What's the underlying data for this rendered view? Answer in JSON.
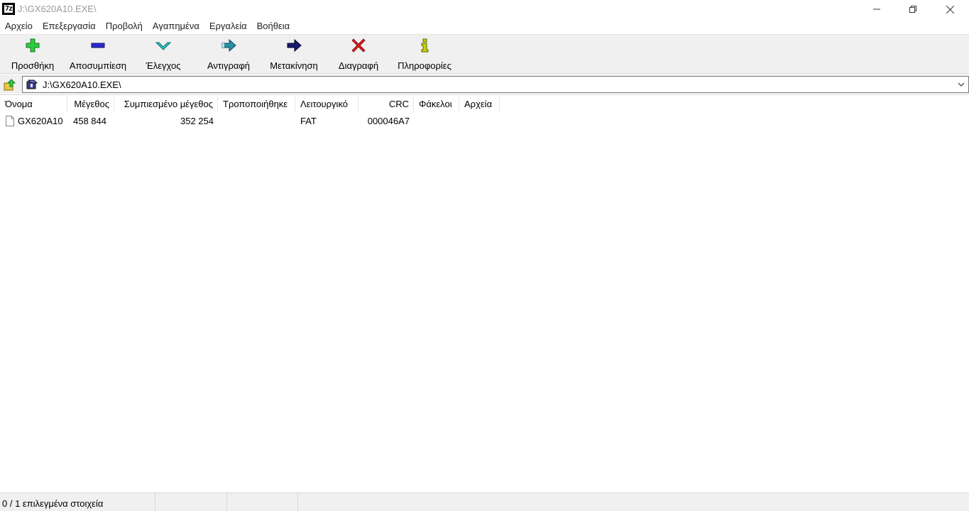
{
  "window": {
    "app_icon_text": "7z",
    "title": "J:\\GX620A10.EXE\\",
    "minimize_glyph": "—",
    "maximize_glyph": "❐",
    "close_glyph": "✕"
  },
  "menu": {
    "items": [
      "Αρχείο",
      "Επεξεργασία",
      "Προβολή",
      "Αγαπημένα",
      "Εργαλεία",
      "Βοήθεια"
    ]
  },
  "toolbar": {
    "buttons": [
      {
        "label": "Προσθήκη",
        "icon": "add-plus-icon",
        "color": "#2ecc40"
      },
      {
        "label": "Αποσυμπίεση",
        "icon": "extract-minus-icon",
        "color": "#2b2bcf"
      },
      {
        "label": "Έλεγχος",
        "icon": "test-check-icon",
        "color": "#2fc4c4"
      },
      {
        "label": "Αντιγραφή",
        "icon": "copy-arrow-icon",
        "color": "#2a8fa8"
      },
      {
        "label": "Μετακίνηση",
        "icon": "move-arrow-icon",
        "color": "#1a1a6e"
      },
      {
        "label": "Διαγραφή",
        "icon": "delete-x-icon",
        "color": "#e01b1b"
      },
      {
        "label": "Πληροφορίες",
        "icon": "info-icon",
        "color": "#c8d400"
      }
    ]
  },
  "address": {
    "path": "J:\\GX620A10.EXE\\"
  },
  "list": {
    "columns": [
      "Όνομα",
      "Μέγεθος",
      "Συμπιεσμένο μέγεθος",
      "Τροποποιήθηκε",
      "Λειτουργικό",
      "CRC",
      "Φάκελοι",
      "Αρχεία"
    ],
    "rows": [
      {
        "name": "GX620A10",
        "size": "458 844",
        "packed": "352 254",
        "modified": "",
        "os": "FAT",
        "crc": "000046A7",
        "folders": "",
        "files": ""
      }
    ]
  },
  "status": {
    "selection": "0 / 1 επιλεγμένα στοιχεία",
    "panel2": "",
    "panel3": ""
  }
}
